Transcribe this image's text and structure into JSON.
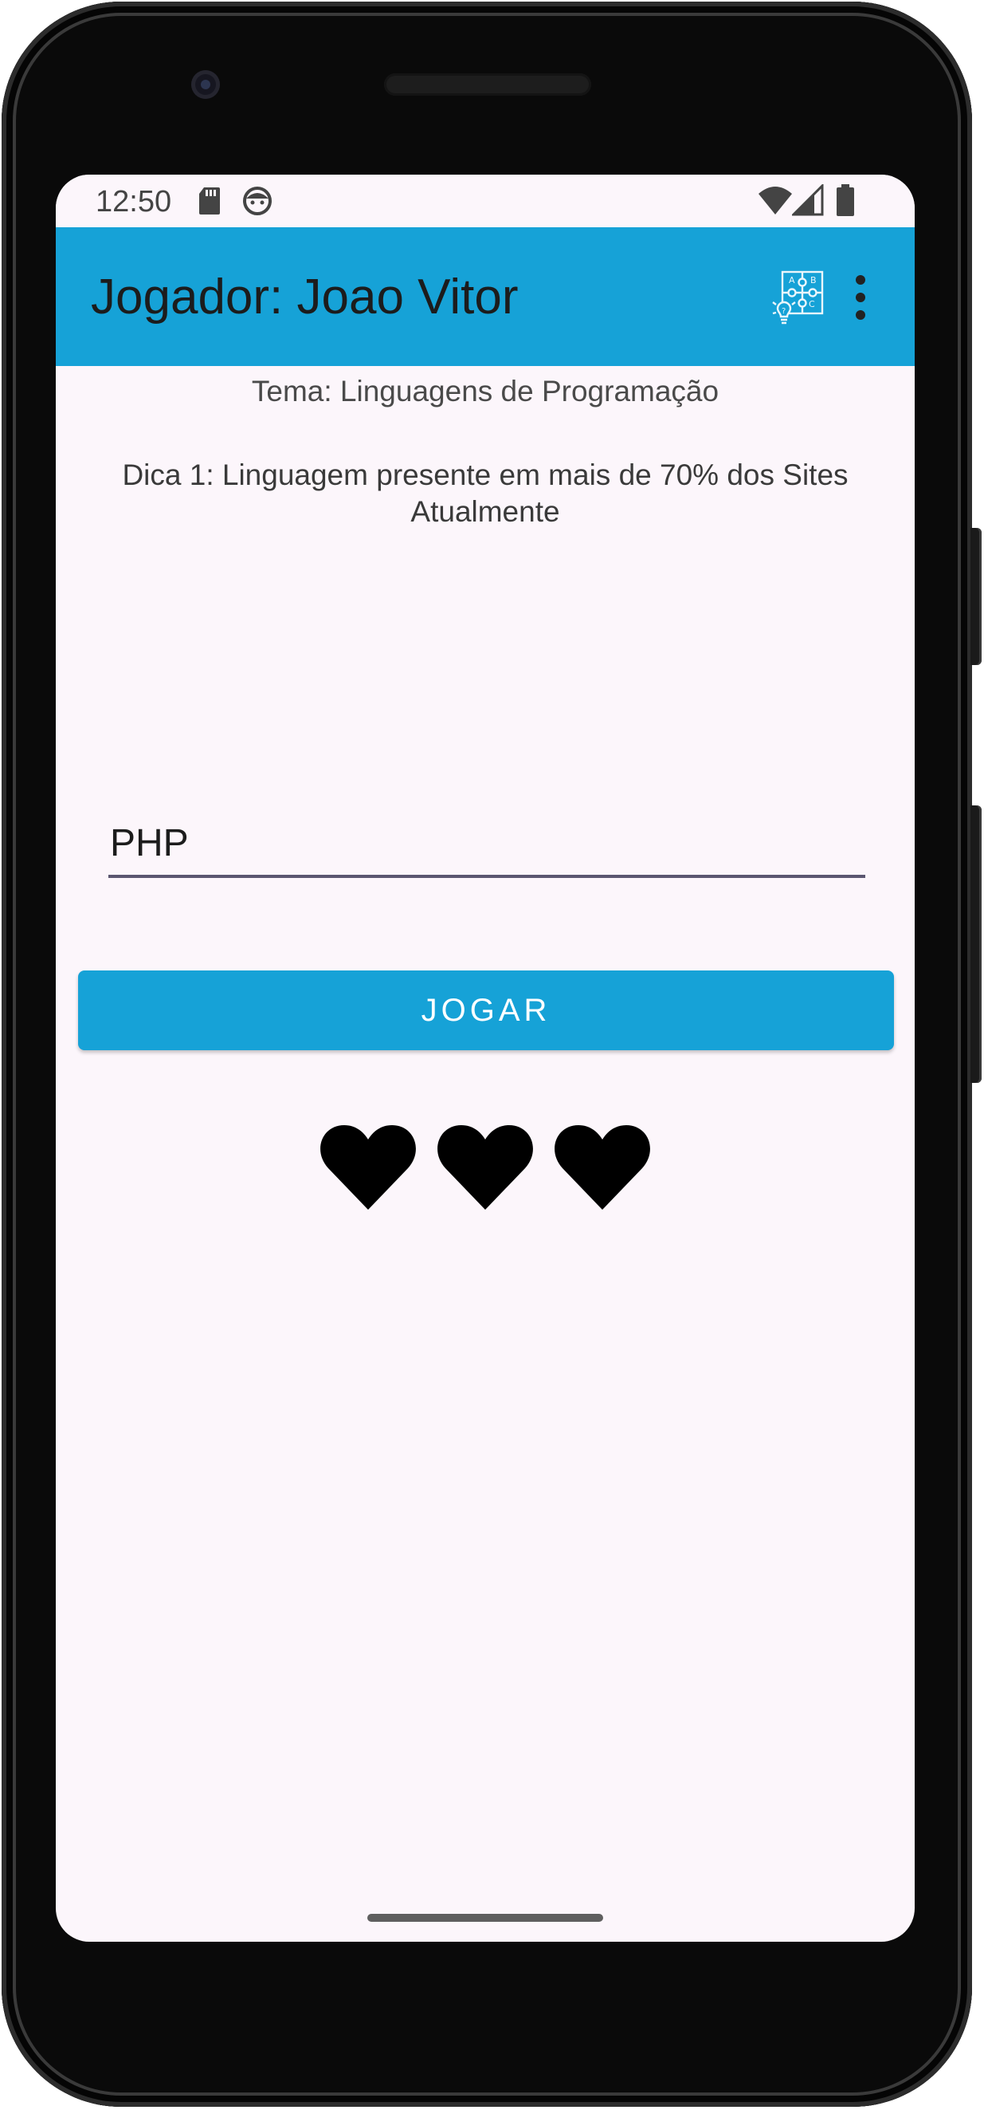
{
  "status_bar": {
    "time": "12:50",
    "icons": [
      "sd-card-icon",
      "face-icon",
      "wifi-icon",
      "signal-icon",
      "battery-icon"
    ]
  },
  "app_bar": {
    "title": "Jogador: Joao Vitor",
    "actions": [
      "puzzle-hint-icon",
      "more-vert-icon"
    ],
    "color": "#16a2d7"
  },
  "game": {
    "theme": "Tema: Linguagens de Programação",
    "hint": "Dica 1: Linguagem presente em mais de 70% dos Sites Atualmente",
    "answer_value": "PHP",
    "play_label": "JOGAR",
    "lives_remaining": 3,
    "lives_icon": "heart-icon"
  },
  "colors": {
    "accent": "#16a2d7",
    "background": "#fcf6fb",
    "underline": "#5b5670"
  }
}
